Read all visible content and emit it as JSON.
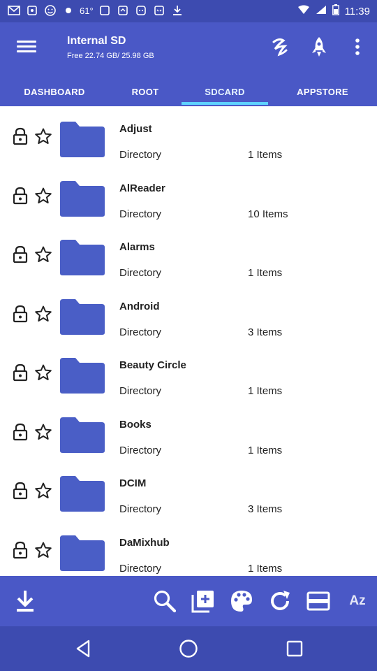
{
  "status_bar": {
    "temperature": "61°",
    "time": "11:39"
  },
  "header": {
    "title": "Internal SD",
    "subtitle": "Free 22.74 GB/ 25.98 GB",
    "actions": [
      "snake-icon",
      "rocket-icon",
      "more-vert-icon"
    ]
  },
  "tabs": [
    {
      "label": "DASHBOARD",
      "active": false
    },
    {
      "label": "ROOT",
      "active": false
    },
    {
      "label": "SDCARD",
      "active": true
    },
    {
      "label": "APPSTORE",
      "active": false
    }
  ],
  "files": [
    {
      "name": "Adjust",
      "type": "Directory",
      "count": "1 Items"
    },
    {
      "name": "AlReader",
      "type": "Directory",
      "count": "10 Items"
    },
    {
      "name": "Alarms",
      "type": "Directory",
      "count": "1 Items"
    },
    {
      "name": "Android",
      "type": "Directory",
      "count": "3 Items"
    },
    {
      "name": "Beauty Circle",
      "type": "Directory",
      "count": "1 Items"
    },
    {
      "name": "Books",
      "type": "Directory",
      "count": "1 Items"
    },
    {
      "name": "DCIM",
      "type": "Directory",
      "count": "3 Items"
    },
    {
      "name": "DaMixhub",
      "type": "Directory",
      "count": "1 Items"
    }
  ],
  "bottom_bar": {
    "sort_label": "Az",
    "icons": [
      "download-icon",
      "search-icon",
      "add-file-icon",
      "palette-icon",
      "refresh-icon",
      "storage-icon",
      "sort-az-icon"
    ]
  },
  "colors": {
    "primary": "#4a58c6",
    "primary_dark": "#3d4bb0",
    "accent": "#5fd2ff",
    "folder": "#4a5ec6"
  }
}
